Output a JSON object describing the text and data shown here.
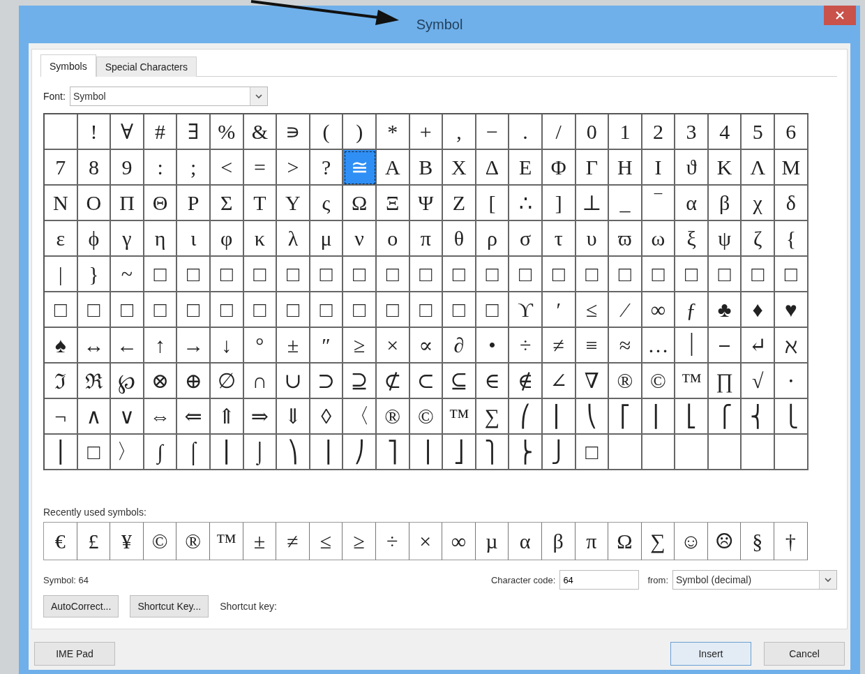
{
  "window": {
    "title": "Symbol"
  },
  "tabs": [
    {
      "label": "Symbols",
      "selected": true
    },
    {
      "label": "Special Characters",
      "selected": false
    }
  ],
  "font": {
    "label": "Font:",
    "value": "Symbol"
  },
  "grid": {
    "rows": [
      [
        {
          "selected": false
        },
        {
          "char": "!",
          "selected": false
        },
        {
          "char": "∀",
          "selected": false
        },
        {
          "char": "#",
          "selected": false
        },
        {
          "char": "∃",
          "selected": false
        },
        {
          "char": "%",
          "selected": false
        },
        {
          "char": "&",
          "selected": false
        },
        {
          "char": "∍",
          "selected": false
        },
        {
          "char": "(",
          "selected": false
        },
        {
          "char": ")",
          "selected": false
        },
        {
          "char": "*",
          "selected": false
        },
        {
          "char": "+",
          "selected": false
        },
        {
          "char": ",",
          "selected": false
        },
        {
          "char": "−",
          "selected": false
        },
        {
          "char": ".",
          "selected": false
        },
        {
          "char": "/",
          "selected": false
        },
        {
          "char": "0",
          "selected": false
        },
        {
          "char": "1",
          "selected": false
        },
        {
          "char": "2",
          "selected": false
        },
        {
          "char": "3",
          "selected": false
        },
        {
          "char": "4",
          "selected": false
        },
        {
          "char": "5",
          "selected": false
        },
        {
          "char": "6",
          "selected": false
        }
      ],
      [
        {
          "char": "7",
          "selected": false
        },
        {
          "char": "8",
          "selected": false
        },
        {
          "char": "9",
          "selected": false
        },
        {
          "char": ":",
          "selected": false
        },
        {
          "char": ";",
          "selected": false
        },
        {
          "char": "<",
          "selected": false
        },
        {
          "char": "=",
          "selected": false
        },
        {
          "char": ">",
          "selected": false
        },
        {
          "char": "?",
          "selected": false
        },
        {
          "char": "≅",
          "selected": true
        },
        {
          "char": "Α",
          "selected": false
        },
        {
          "char": "Β",
          "selected": false
        },
        {
          "char": "Χ",
          "selected": false
        },
        {
          "char": "Δ",
          "selected": false
        },
        {
          "char": "Ε",
          "selected": false
        },
        {
          "char": "Φ",
          "selected": false
        },
        {
          "char": "Γ",
          "selected": false
        },
        {
          "char": "Η",
          "selected": false
        },
        {
          "char": "Ι",
          "selected": false
        },
        {
          "char": "ϑ",
          "selected": false
        },
        {
          "char": "Κ",
          "selected": false
        },
        {
          "char": "Λ",
          "selected": false
        },
        {
          "char": "Μ",
          "selected": false
        }
      ],
      [
        {
          "char": "Ν",
          "selected": false
        },
        {
          "char": "Ο",
          "selected": false
        },
        {
          "char": "Π",
          "selected": false
        },
        {
          "char": "Θ",
          "selected": false
        },
        {
          "char": "Ρ",
          "selected": false
        },
        {
          "char": "Σ",
          "selected": false
        },
        {
          "char": "Τ",
          "selected": false
        },
        {
          "char": "Υ",
          "selected": false
        },
        {
          "char": "ς",
          "selected": false
        },
        {
          "char": "Ω",
          "selected": false
        },
        {
          "char": "Ξ",
          "selected": false
        },
        {
          "char": "Ψ",
          "selected": false
        },
        {
          "char": "Ζ",
          "selected": false
        },
        {
          "char": "[",
          "selected": false
        },
        {
          "char": "∴",
          "selected": false
        },
        {
          "char": "]",
          "selected": false
        },
        {
          "char": "⊥",
          "selected": false
        },
        {
          "char": "_",
          "selected": false
        },
        {
          "char": "‾",
          "selected": false
        },
        {
          "char": "α",
          "selected": false
        },
        {
          "char": "β",
          "selected": false
        },
        {
          "char": "χ",
          "selected": false
        },
        {
          "char": "δ",
          "selected": false
        }
      ],
      [
        {
          "char": "ε",
          "selected": false
        },
        {
          "char": "ϕ",
          "selected": false
        },
        {
          "char": "γ",
          "selected": false
        },
        {
          "char": "η",
          "selected": false
        },
        {
          "char": "ι",
          "selected": false
        },
        {
          "char": "φ",
          "selected": false
        },
        {
          "char": "κ",
          "selected": false
        },
        {
          "char": "λ",
          "selected": false
        },
        {
          "char": "μ",
          "selected": false
        },
        {
          "char": "ν",
          "selected": false
        },
        {
          "char": "ο",
          "selected": false
        },
        {
          "char": "π",
          "selected": false
        },
        {
          "char": "θ",
          "selected": false
        },
        {
          "char": "ρ",
          "selected": false
        },
        {
          "char": "σ",
          "selected": false
        },
        {
          "char": "τ",
          "selected": false
        },
        {
          "char": "υ",
          "selected": false
        },
        {
          "char": "ϖ",
          "selected": false
        },
        {
          "char": "ω",
          "selected": false
        },
        {
          "char": "ξ",
          "selected": false
        },
        {
          "char": "ψ",
          "selected": false
        },
        {
          "char": "ζ",
          "selected": false
        },
        {
          "char": "{",
          "selected": false
        }
      ],
      [
        {
          "char": "|",
          "selected": false
        },
        {
          "char": "}",
          "selected": false
        },
        {
          "char": "~",
          "selected": false
        },
        {
          "char": "□",
          "selected": false
        },
        {
          "char": "□",
          "selected": false
        },
        {
          "char": "□",
          "selected": false
        },
        {
          "char": "□",
          "selected": false
        },
        {
          "char": "□",
          "selected": false
        },
        {
          "char": "□",
          "selected": false
        },
        {
          "char": "□",
          "selected": false
        },
        {
          "char": "□",
          "selected": false
        },
        {
          "char": "□",
          "selected": false
        },
        {
          "char": "□",
          "selected": false
        },
        {
          "char": "□",
          "selected": false
        },
        {
          "char": "□",
          "selected": false
        },
        {
          "char": "□",
          "selected": false
        },
        {
          "char": "□",
          "selected": false
        },
        {
          "char": "□",
          "selected": false
        },
        {
          "char": "□",
          "selected": false
        },
        {
          "char": "□",
          "selected": false
        },
        {
          "char": "□",
          "selected": false
        },
        {
          "char": "□",
          "selected": false
        },
        {
          "char": "□",
          "selected": false
        }
      ],
      [
        {
          "char": "□",
          "selected": false
        },
        {
          "char": "□",
          "selected": false
        },
        {
          "char": "□",
          "selected": false
        },
        {
          "char": "□",
          "selected": false
        },
        {
          "char": "□",
          "selected": false
        },
        {
          "char": "□",
          "selected": false
        },
        {
          "char": "□",
          "selected": false
        },
        {
          "char": "□",
          "selected": false
        },
        {
          "char": "□",
          "selected": false
        },
        {
          "char": "□",
          "selected": false
        },
        {
          "char": "□",
          "selected": false
        },
        {
          "char": "□",
          "selected": false
        },
        {
          "char": "□",
          "selected": false
        },
        {
          "char": "□",
          "selected": false
        },
        {
          "char": "ϒ",
          "selected": false
        },
        {
          "char": "′",
          "selected": false
        },
        {
          "char": "≤",
          "selected": false
        },
        {
          "char": "⁄",
          "selected": false
        },
        {
          "char": "∞",
          "selected": false
        },
        {
          "char": "ƒ",
          "selected": false
        },
        {
          "char": "♣",
          "selected": false
        },
        {
          "char": "♦",
          "selected": false
        },
        {
          "char": "♥",
          "selected": false
        }
      ],
      [
        {
          "char": "♠",
          "selected": false
        },
        {
          "char": "↔",
          "selected": false
        },
        {
          "char": "←",
          "selected": false
        },
        {
          "char": "↑",
          "selected": false
        },
        {
          "char": "→",
          "selected": false
        },
        {
          "char": "↓",
          "selected": false
        },
        {
          "char": "°",
          "selected": false
        },
        {
          "char": "±",
          "selected": false
        },
        {
          "char": "″",
          "selected": false
        },
        {
          "char": "≥",
          "selected": false
        },
        {
          "char": "×",
          "selected": false
        },
        {
          "char": "∝",
          "selected": false
        },
        {
          "char": "∂",
          "selected": false
        },
        {
          "char": "•",
          "selected": false
        },
        {
          "char": "÷",
          "selected": false
        },
        {
          "char": "≠",
          "selected": false
        },
        {
          "char": "≡",
          "selected": false
        },
        {
          "char": "≈",
          "selected": false
        },
        {
          "char": "…",
          "selected": false
        },
        {
          "char": "⏐",
          "selected": false
        },
        {
          "char": "⎯",
          "selected": false
        },
        {
          "char": "↵",
          "selected": false
        },
        {
          "char": "ℵ",
          "selected": false
        }
      ],
      [
        {
          "char": "ℑ",
          "selected": false
        },
        {
          "char": "ℜ",
          "selected": false
        },
        {
          "char": "℘",
          "selected": false
        },
        {
          "char": "⊗",
          "selected": false
        },
        {
          "char": "⊕",
          "selected": false
        },
        {
          "char": "∅",
          "selected": false
        },
        {
          "char": "∩",
          "selected": false
        },
        {
          "char": "∪",
          "selected": false
        },
        {
          "char": "⊃",
          "selected": false
        },
        {
          "char": "⊇",
          "selected": false
        },
        {
          "char": "⊄",
          "selected": false
        },
        {
          "char": "⊂",
          "selected": false
        },
        {
          "char": "⊆",
          "selected": false
        },
        {
          "char": "∈",
          "selected": false
        },
        {
          "char": "∉",
          "selected": false
        },
        {
          "char": "∠",
          "selected": false
        },
        {
          "char": "∇",
          "selected": false
        },
        {
          "char": "®",
          "selected": false
        },
        {
          "char": "©",
          "selected": false
        },
        {
          "char": "™",
          "selected": false
        },
        {
          "char": "∏",
          "selected": false
        },
        {
          "char": "√",
          "selected": false
        },
        {
          "char": "⋅",
          "selected": false
        }
      ],
      [
        {
          "char": "¬",
          "selected": false
        },
        {
          "char": "∧",
          "selected": false
        },
        {
          "char": "∨",
          "selected": false
        },
        {
          "char": "⇔",
          "selected": false
        },
        {
          "char": "⇐",
          "selected": false
        },
        {
          "char": "⇑",
          "selected": false
        },
        {
          "char": "⇒",
          "selected": false
        },
        {
          "char": "⇓",
          "selected": false
        },
        {
          "char": "◊",
          "selected": false
        },
        {
          "char": "〈",
          "selected": false
        },
        {
          "char": "®",
          "selected": false
        },
        {
          "char": "©",
          "selected": false
        },
        {
          "char": "™",
          "selected": false
        },
        {
          "char": "∑",
          "selected": false
        },
        {
          "char": "⎛",
          "selected": false
        },
        {
          "char": "⎜",
          "selected": false
        },
        {
          "char": "⎝",
          "selected": false
        },
        {
          "char": "⎡",
          "selected": false
        },
        {
          "char": "⎢",
          "selected": false
        },
        {
          "char": "⎣",
          "selected": false
        },
        {
          "char": "⎧",
          "selected": false
        },
        {
          "char": "⎨",
          "selected": false
        },
        {
          "char": "⎩",
          "selected": false
        }
      ],
      [
        {
          "char": "⎪",
          "selected": false
        },
        {
          "char": "□",
          "selected": false
        },
        {
          "char": "〉",
          "selected": false
        },
        {
          "char": "∫",
          "selected": false
        },
        {
          "char": "⌠",
          "selected": false
        },
        {
          "char": "⎮",
          "selected": false
        },
        {
          "char": "⌡",
          "selected": false
        },
        {
          "char": "⎞",
          "selected": false
        },
        {
          "char": "⎟",
          "selected": false
        },
        {
          "char": "⎠",
          "selected": false
        },
        {
          "char": "⎤",
          "selected": false
        },
        {
          "char": "⎥",
          "selected": false
        },
        {
          "char": "⎦",
          "selected": false
        },
        {
          "char": "⎫",
          "selected": false
        },
        {
          "char": "⎬",
          "selected": false
        },
        {
          "char": "⎭",
          "selected": false
        },
        {
          "char": "□",
          "selected": false
        },
        {
          "selected": false
        },
        {
          "selected": false
        },
        {
          "selected": false
        },
        {
          "selected": false
        },
        {
          "selected": false
        },
        {
          "selected": false
        }
      ]
    ]
  },
  "recent": {
    "label": "Recently used symbols:",
    "symbols": [
      "€",
      "£",
      "¥",
      "©",
      "®",
      "™",
      "±",
      "≠",
      "≤",
      "≥",
      "÷",
      "×",
      "∞",
      "µ",
      "α",
      "β",
      "π",
      "Ω",
      "∑",
      "☺",
      "☹",
      "§",
      "†"
    ]
  },
  "symbol_info": "Symbol: 64",
  "character_code": {
    "label": "Character code:",
    "value": "64"
  },
  "from": {
    "label": "from:",
    "value": "Symbol (decimal)"
  },
  "buttons": [
    "AutoCorrect...",
    "Shortcut Key..."
  ],
  "shortcut_label": "Shortcut key:",
  "footer_left": "IME Pad",
  "footer_buttons": [
    "Insert",
    "Cancel"
  ]
}
